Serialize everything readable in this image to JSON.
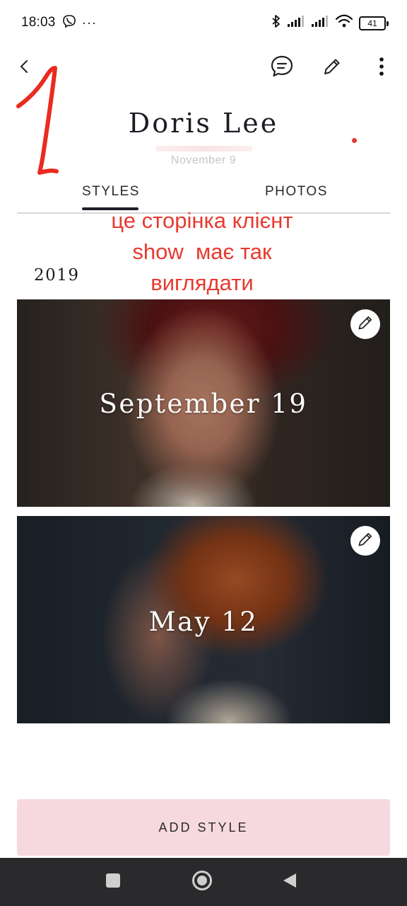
{
  "status_bar": {
    "time": "18:03",
    "more": "···",
    "battery": "41"
  },
  "app_bar": {
    "back_icon": "chevron-left-icon",
    "actions": [
      "chat-icon",
      "pencil-icon",
      "more-vertical-icon"
    ]
  },
  "client": {
    "name": "Doris Lee",
    "date": "November 9"
  },
  "annotations": {
    "number": "1",
    "note_line1": "це сторінка клієнт",
    "note_line2": "show  має так",
    "note_line3": "виглядати",
    "color": "#e73a2f"
  },
  "tabs": [
    {
      "label": "STYLES",
      "active": true
    },
    {
      "label": "PHOTOS",
      "active": false
    }
  ],
  "year": "2019",
  "styles": [
    {
      "title": "September 19",
      "edit_icon": "pencil-icon"
    },
    {
      "title": "May 12",
      "edit_icon": "pencil-icon"
    }
  ],
  "add_style_label": "ADD STYLE",
  "colors": {
    "accent_button": "#f6d9de",
    "text_dark": "#1c1c24",
    "nav_bar": "#2a2a2d"
  },
  "nav_bar": {
    "buttons": [
      "recents-icon",
      "home-icon",
      "back-icon"
    ]
  }
}
